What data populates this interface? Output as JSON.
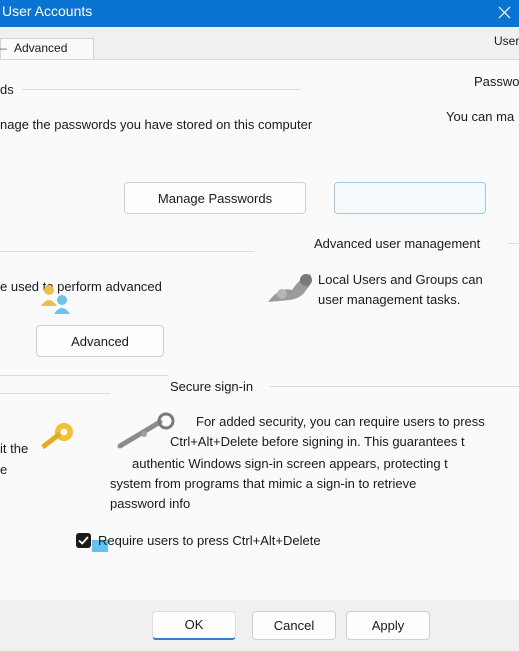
{
  "window": {
    "title": "User Accounts",
    "close_glyph": "✕",
    "right_tab_fragment": "User"
  },
  "tabs": [
    {
      "label": "Advanced",
      "active": true
    }
  ],
  "passwords_section": {
    "heading_fragment": "ds",
    "right_heading_fragment": "Passwo",
    "description": "nage the passwords you have stored on this computer",
    "right_description_fragment": "You can ma",
    "manage_button": "Manage Passwords"
  },
  "advanced_user_mgmt": {
    "left_text_fragment": "e used to perform advanced",
    "heading": "Advanced user management",
    "description_lines": [
      "Local Users and Groups can",
      "user management tasks."
    ],
    "advanced_button": "Advanced"
  },
  "secure_signin": {
    "heading": "Secure sign-in",
    "left_fragments": [
      "it the",
      "e"
    ],
    "description_lines": [
      "For added security, you can require users to press",
      "Ctrl+Alt+Delete before signing in. This guarantees t",
      "authentic Windows sign-in screen appears, protecting t",
      "system from programs that mimic a sign-in to retrieve",
      "password info"
    ],
    "checkbox_label": "Require users to press Ctrl+Alt+Delete",
    "checkbox_checked": true
  },
  "footer": {
    "ok": "OK",
    "cancel": "Cancel",
    "apply": "Apply"
  },
  "colors": {
    "titlebar": "#0a74d4",
    "accent": "#3a7bd5"
  }
}
